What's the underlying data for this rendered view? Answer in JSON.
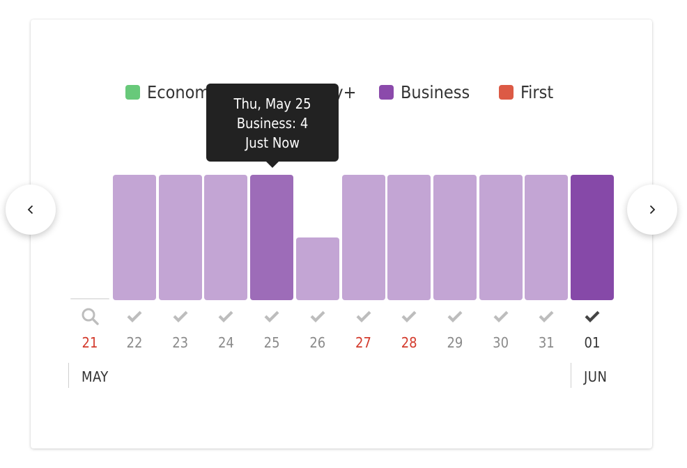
{
  "chart_data": {
    "type": "bar",
    "title": "",
    "xlabel": "",
    "ylabel": "",
    "ylim": [
      0,
      8
    ],
    "legend_position": "top",
    "legend": [
      {
        "name": "Economy",
        "color": "#68c97a"
      },
      {
        "name": "Economy+",
        "color": "#3a8fc2"
      },
      {
        "name": "Business",
        "color": "#8b4aab"
      },
      {
        "name": "First",
        "color": "#dc5a45"
      }
    ],
    "categories": [
      "21",
      "22",
      "23",
      "24",
      "25",
      "26",
      "27",
      "28",
      "29",
      "30",
      "31",
      "01"
    ],
    "dates": [
      "May 21",
      "May 22",
      "May 23",
      "May 24",
      "May 25",
      "May 26",
      "May 27",
      "May 28",
      "May 29",
      "May 30",
      "May 31",
      "Jun 01"
    ],
    "series": [
      {
        "name": "Business",
        "values": [
          0,
          8,
          8,
          8,
          8,
          4,
          8,
          8,
          8,
          8,
          8,
          8
        ]
      }
    ],
    "bar_states": [
      "empty",
      "normal",
      "normal",
      "normal",
      "hover",
      "normal",
      "normal",
      "normal",
      "normal",
      "normal",
      "normal",
      "selected"
    ],
    "day_status": [
      "search",
      "check",
      "check",
      "check",
      "check",
      "check",
      "check",
      "check",
      "check",
      "check",
      "check",
      "check-active"
    ],
    "day_highlight": [
      "red",
      "grey",
      "grey",
      "grey",
      "grey",
      "grey",
      "red",
      "red",
      "grey",
      "grey",
      "grey",
      "dark"
    ],
    "months": [
      "MAY",
      "JUN"
    ]
  },
  "colors": {
    "bar_normal": "#c3a5d4",
    "bar_hover": "#9d6cb8",
    "bar_selected": "#8649a8",
    "day_red": "#d33a2c",
    "day_grey": "#8a8a8a",
    "day_dark": "#333333",
    "check_grey": "#bdbdbd",
    "check_dark": "#444444"
  },
  "tooltip": {
    "line1": "Thu, May 25",
    "line2": "Business: 4",
    "line3": "Just Now"
  },
  "nav": {
    "prev_icon": "chevron-left-icon",
    "next_icon": "chevron-right-icon"
  }
}
